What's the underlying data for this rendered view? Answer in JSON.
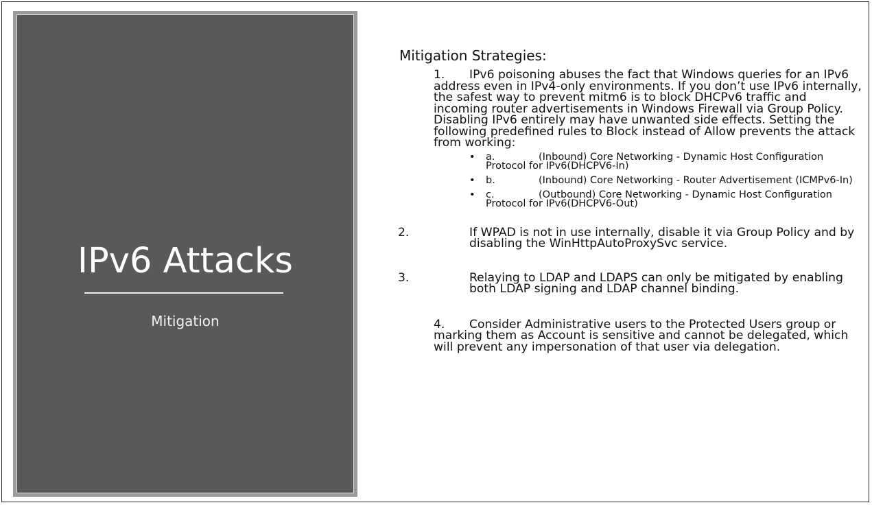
{
  "title_panel": {
    "title": "IPv6 Attacks",
    "subtitle": "Mitigation"
  },
  "content": {
    "heading": "Mitigation Strategies:",
    "items": [
      {
        "number": "1.",
        "text": "IPv6 poisoning abuses the fact that Windows queries for an IPv6 address even in IPv4-only environments. If you don’t use IPv6 internally, the safest way to prevent mitm6 is to block DHCPv6 traffic and incoming router advertisements in Windows Firewall via Group Policy. Disabling IPv6 entirely may have unwanted side effects. Setting the following predefined rules to Block instead of Allow prevents the attack from working:",
        "subitems": [
          {
            "bullet": "•",
            "letter": "a.",
            "text": "(Inbound) Core Networking - Dynamic Host Configuration Protocol for IPv6(DHCPV6-In)"
          },
          {
            "bullet": "•",
            "letter": "b.",
            "text": "(Inbound) Core Networking - Router Advertisement (ICMPv6-In)"
          },
          {
            "bullet": "•",
            "letter": "c.",
            "text": "(Outbound) Core Networking - Dynamic Host Configuration Protocol for IPv6(DHCPV6-Out)"
          }
        ]
      },
      {
        "number": "2.",
        "text": "If WPAD is not in use internally, disable it via Group Policy and by disabling the WinHttpAutoProxySvc service."
      },
      {
        "number": "3.",
        "text": "Relaying to LDAP and LDAPS can only be mitigated by enabling both LDAP signing and LDAP channel binding."
      },
      {
        "number": "4.",
        "text": "Consider Administrative users to the Protected Users group or marking them as Account is sensitive and cannot be delegated, which will prevent any impersonation of that user via delegation."
      }
    ]
  }
}
